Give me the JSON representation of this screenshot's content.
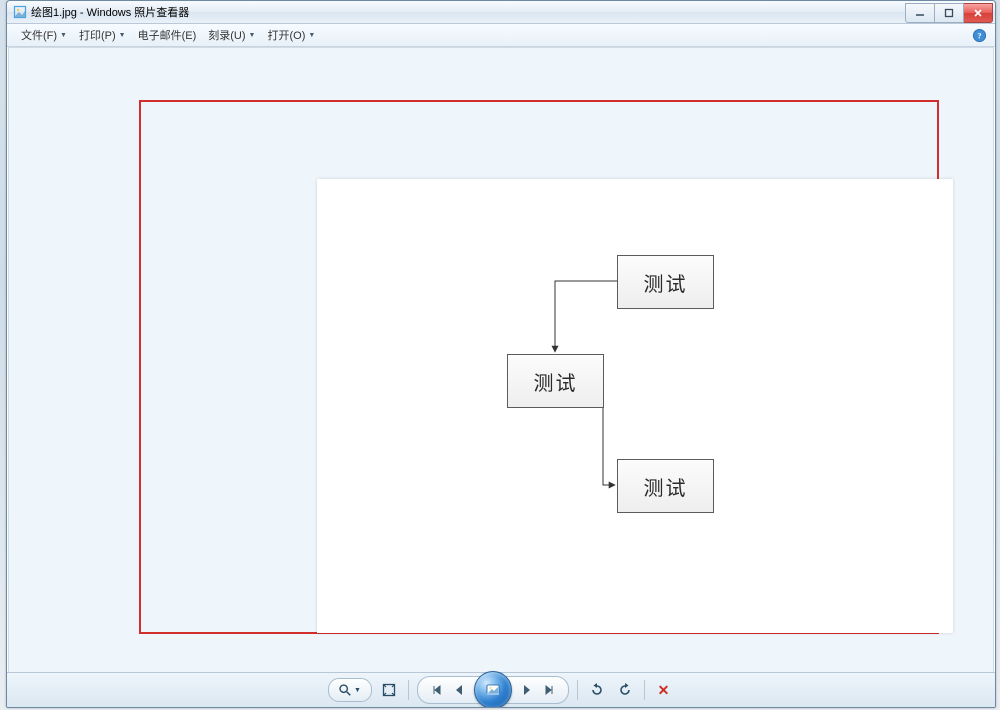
{
  "window": {
    "title": "绘图1.jpg - Windows 照片查看器"
  },
  "menu": {
    "items": [
      {
        "label": "文件(F)"
      },
      {
        "label": "打印(P)"
      },
      {
        "label": "电子邮件(E)"
      },
      {
        "label": "刻录(U)"
      },
      {
        "label": "打开(O)"
      }
    ]
  },
  "toolbar": {
    "zoom": "zoom",
    "fit": "fit-to-window",
    "first": "first",
    "prev": "previous",
    "play": "play-slideshow",
    "next": "next",
    "last": "last",
    "rotate_ccw": "rotate-counterclockwise",
    "rotate_cw": "rotate-clockwise",
    "delete": "delete"
  },
  "diagram": {
    "nodes": [
      {
        "id": "n1",
        "label": "测试"
      },
      {
        "id": "n2",
        "label": "测试"
      },
      {
        "id": "n3",
        "label": "测试"
      }
    ],
    "edges": [
      {
        "from": "n1",
        "to": "n2"
      },
      {
        "from": "n2",
        "to": "n3"
      }
    ]
  }
}
